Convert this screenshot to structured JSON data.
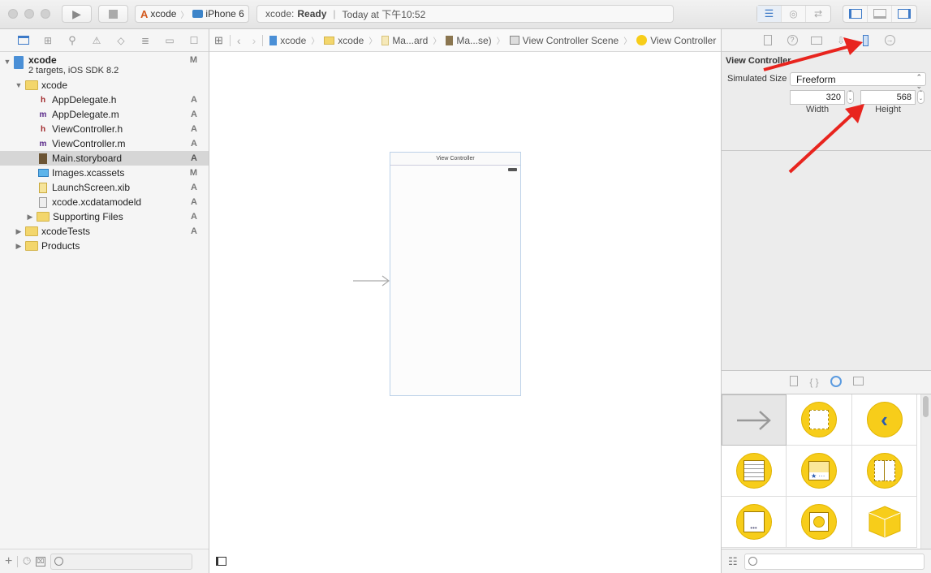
{
  "toolbar": {
    "scheme": {
      "target": "xcode",
      "device": "iPhone 6"
    },
    "status": {
      "project": "xcode:",
      "state": "Ready",
      "time": "Today at 下午10:52"
    },
    "icons": [
      "run-icon",
      "stop-icon",
      "standard-editor-icon",
      "assistant-editor-icon",
      "version-editor-icon",
      "navigator-toggle-icon",
      "debug-area-toggle-icon",
      "utilities-toggle-icon"
    ]
  },
  "navigator": {
    "tab_icons": [
      "project-navigator-icon",
      "symbol-navigator-icon",
      "find-navigator-icon",
      "issue-navigator-icon",
      "test-navigator-icon",
      "debug-navigator-icon",
      "breakpoint-navigator-icon",
      "report-navigator-icon"
    ],
    "project": {
      "name": "xcode",
      "subtitle": "2 targets, iOS SDK 8.2",
      "badge": "M"
    },
    "items": [
      {
        "label": "xcode",
        "type": "folder",
        "level": 1,
        "expanded": true,
        "badge": ""
      },
      {
        "label": "AppDelegate.h",
        "type": "h",
        "level": 2,
        "badge": "A"
      },
      {
        "label": "AppDelegate.m",
        "type": "m",
        "level": 2,
        "badge": "A"
      },
      {
        "label": "ViewController.h",
        "type": "h",
        "level": 2,
        "badge": "A"
      },
      {
        "label": "ViewController.m",
        "type": "m",
        "level": 2,
        "badge": "A"
      },
      {
        "label": "Main.storyboard",
        "type": "storyboard",
        "level": 2,
        "badge": "A",
        "selected": true
      },
      {
        "label": "Images.xcassets",
        "type": "xcassets",
        "level": 2,
        "badge": "M"
      },
      {
        "label": "LaunchScreen.xib",
        "type": "xib",
        "level": 2,
        "badge": "A"
      },
      {
        "label": "xcode.xcdatamodeld",
        "type": "datamodel",
        "level": 2,
        "badge": "A"
      },
      {
        "label": "Supporting Files",
        "type": "folder",
        "level": 2,
        "expanded": false,
        "badge": "A"
      },
      {
        "label": "xcodeTests",
        "type": "folder",
        "level": 1,
        "expanded": false,
        "badge": "A"
      },
      {
        "label": "Products",
        "type": "folder",
        "level": 1,
        "expanded": false,
        "badge": ""
      }
    ],
    "filter_placeholder": ""
  },
  "editor": {
    "jumpbar": [
      "xcode",
      "xcode",
      "Ma...ard",
      "Ma...se)",
      "View Controller Scene",
      "View Controller"
    ],
    "scene_title": "View Controller"
  },
  "inspector": {
    "section_title": "View Controller",
    "simulated_size_label": "Simulated Size",
    "simulated_size_value": "Freeform",
    "width_value": "320",
    "width_label": "Width",
    "height_value": "568",
    "height_label": "Height",
    "annotation_color": "#e8241e"
  },
  "library": {
    "tab_icons": [
      "file-template-icon",
      "code-snippet-icon",
      "object-library-icon",
      "media-library-icon"
    ],
    "items": [
      "storyboard-reference-arrow",
      "view-controller",
      "navigation-controller",
      "table-view-controller",
      "tab-bar-controller",
      "split-view-controller",
      "page-view-controller",
      "glkit-view-controller",
      "object"
    ],
    "filter_placeholder": ""
  }
}
